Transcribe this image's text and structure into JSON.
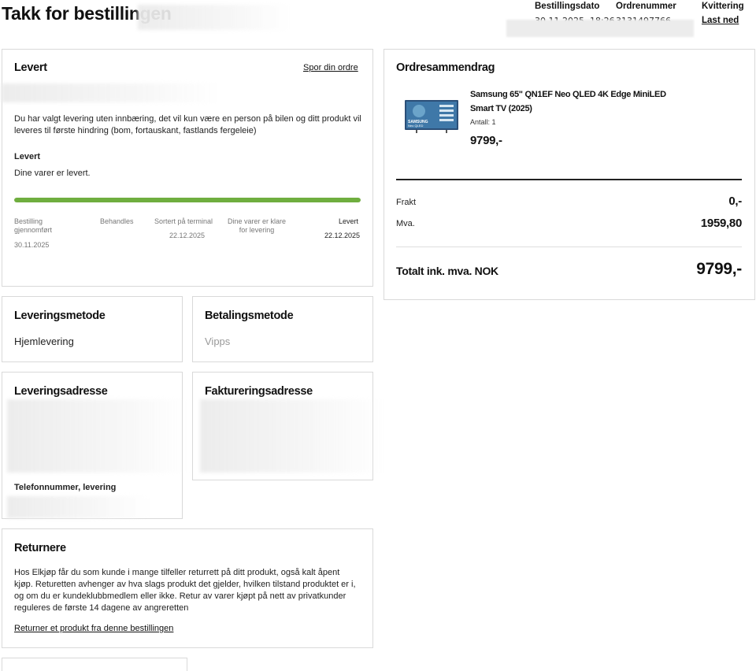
{
  "header": {
    "title": "Takk for bestillingen",
    "order_date_label": "Bestillingsdato",
    "order_date_value": "30.11.2025, 18:26",
    "order_number_label": "Ordrenummer",
    "order_number_value": "3131497766",
    "receipt_label": "Kvittering",
    "receipt_link": "Last ned"
  },
  "status_card": {
    "title": "Levert",
    "track_link": "Spor din ordre",
    "delivery_info": "Du har valgt levering uten innbæring, det vil kun være en person på bilen og ditt produkt vil leveres til første hindring (bom, fortauskant, fastlands fergeleie)",
    "status_heading": "Levert",
    "status_text": "Dine varer er levert.",
    "progress_fraction": 1.0,
    "accent_color": "#6fae3f",
    "steps": [
      {
        "label": "Bestilling gjennomført",
        "date": "30.11.2025"
      },
      {
        "label": "Behandles",
        "date": ""
      },
      {
        "label": "Sortert på terminal",
        "date": "22.12.2025"
      },
      {
        "label": "Dine varer er klare for levering",
        "date": ""
      },
      {
        "label": "Levert",
        "date": "22.12.2025"
      }
    ]
  },
  "summary": {
    "title": "Ordresammendrag",
    "product_name": "Samsung 65\" QN1EF Neo QLED 4K Edge MiniLED Smart TV (2025)",
    "product_image_icon": "tv-product-thumbnail",
    "product_image_brand": "SAMSUNG",
    "product_image_line": "Neo QLED",
    "quantity": "Antall: 1",
    "product_price": "9799,-",
    "shipping_label": "Frakt",
    "shipping_value": "0,-",
    "vat_label": "Mva.",
    "vat_value": "1959,80",
    "total_label": "Totalt ink. mva. NOK",
    "total_value": "9799,-"
  },
  "delivery_method": {
    "title": "Leveringsmetode",
    "value": "Hjemlevering"
  },
  "payment_method": {
    "title": "Betalingsmetode",
    "value": "Vipps"
  },
  "delivery_address": {
    "title": "Leveringsadresse",
    "phone_label": "Telefonnummer, levering"
  },
  "billing_address": {
    "title": "Faktureringsadresse"
  },
  "returns": {
    "title": "Returnere",
    "text": "Hos Elkjøp får du som kunde i mange tilfeller returrett på ditt produkt, også kalt åpent kjøp. Returetten avhenger av hva slags produkt det gjelder, hvilken tilstand produktet er i, og om du er kundeklubbmedlem eller ikke. Retur av varer kjøpt på nett av privatkunder reguleres de første 14 dagene av angreretten",
    "link": "Returner et produkt fra denne bestillingen"
  }
}
